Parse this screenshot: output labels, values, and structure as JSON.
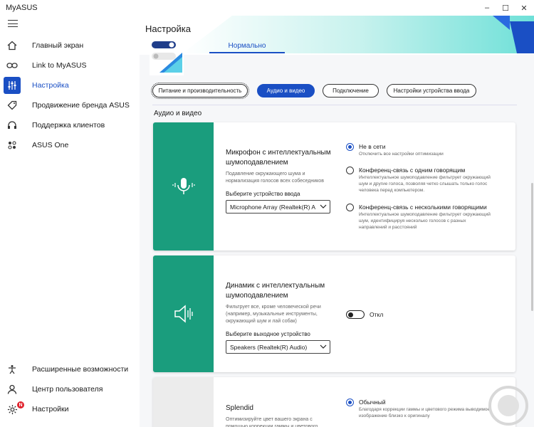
{
  "app": {
    "title": "MyASUS"
  },
  "window": {
    "minimize": "–",
    "maximize": "☐",
    "close": "✕"
  },
  "sidebar": {
    "items": [
      {
        "label": "Главный экран",
        "icon": "home-icon"
      },
      {
        "label": "Link to MyASUS",
        "icon": "link-icon"
      },
      {
        "label": "Настройка",
        "icon": "sliders-icon",
        "active": true
      },
      {
        "label": "Продвижение бренда ASUS",
        "icon": "tag-icon"
      },
      {
        "label": "Поддержка клиентов",
        "icon": "headset-icon"
      },
      {
        "label": "ASUS One",
        "icon": "dots-icon"
      }
    ],
    "bottom_items": [
      {
        "label": "Расширенные возможности",
        "icon": "accessibility-icon"
      },
      {
        "label": "Центр пользователя",
        "icon": "user-icon"
      },
      {
        "label": "Настройки",
        "icon": "gear-icon",
        "badge": "N"
      }
    ]
  },
  "main": {
    "title": "Настройка",
    "mode_tab": "Нормально",
    "pills": [
      "Питание и производительность",
      "Аудио и видео",
      "Подключение",
      "Настройки устройства ввода"
    ],
    "selected_pill": "Аудио и видео",
    "section_title": "Аудио и видео"
  },
  "mic_card": {
    "title": "Микрофон с интеллектуальным шумоподавлением",
    "desc": "Подавление окружающего шума и нормализация голосов всех собеседников",
    "select_label": "Выберите устройство ввода",
    "select_value": "Microphone Array (Realtek(R) A",
    "options": [
      {
        "title": "Не в сети",
        "desc": "Отключить все настройки оптимизации",
        "selected": true
      },
      {
        "title": "Конференц-связь с одним говорящим",
        "desc": "Интеллектуальное шумоподавление фильтрует окружающий шум и другие голоса, позволяя четко слышать только голос человека перед компьютером.",
        "selected": false
      },
      {
        "title": "Конференц-связь с несколькими говорящими",
        "desc": "Интеллектуальное шумоподавление фильтрует окружающий шум, идентифицируя несколько голосов с разных направлений и расстояний",
        "selected": false
      }
    ]
  },
  "speaker_card": {
    "title": "Динамик с интеллектуальным шумоподавлением",
    "desc": "Фильтрует все, кроме человеческой речи (например, музыкальные инструменты, окружающий шум и лай собак)",
    "select_label": "Выберите выходное устройство",
    "select_value": "Speakers (Realtek(R) Audio)",
    "toggle_label": "Откл",
    "toggle_on": false
  },
  "splendid_card": {
    "title": "Splendid",
    "desc": "Оптимизируйте цвет вашего экрана с помощью коррекции гаммы и цветового",
    "options": [
      {
        "title": "Обычный",
        "desc": "Благодаря коррекции гаммы и цветового режима выводимое изображение близко к оригиналу",
        "selected": true
      }
    ]
  },
  "colors": {
    "accent": "#1a4fc4",
    "card_green": "#1a9d7d"
  }
}
